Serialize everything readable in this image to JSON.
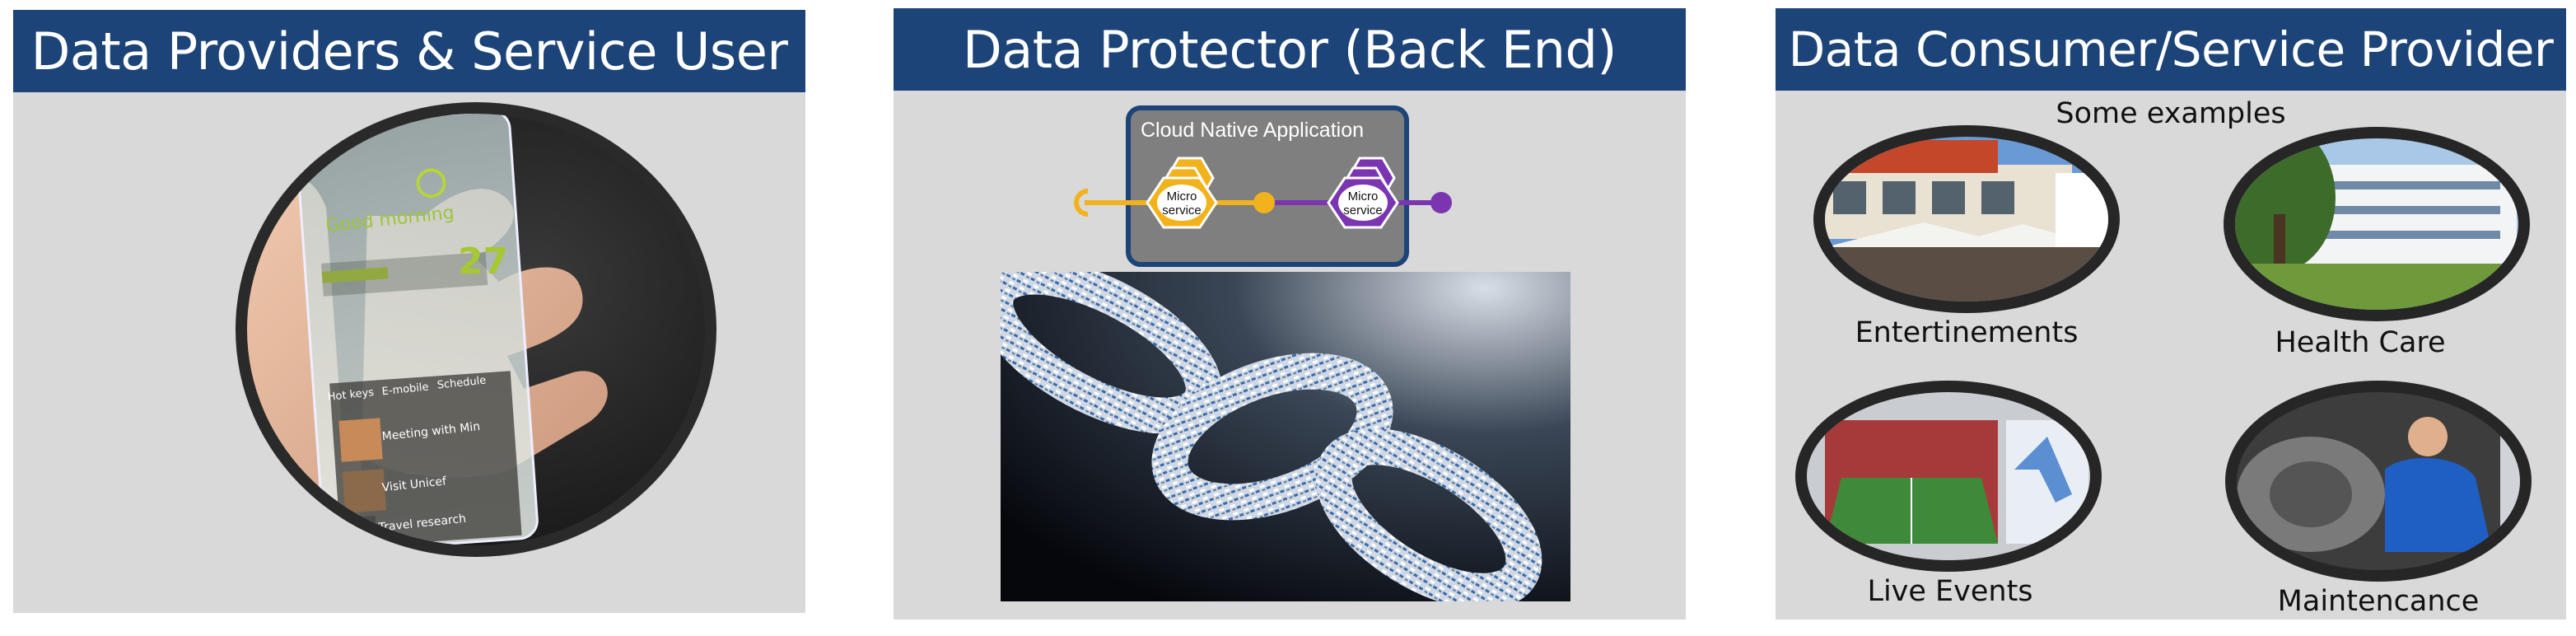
{
  "panels": {
    "left": {
      "title": "Data Providers & Service User"
    },
    "middle": {
      "title": "Data Protector (Back End)",
      "cloud_box": {
        "title": "Cloud Native Application",
        "services": [
          {
            "label": "Micro service",
            "color": "#f2b21b"
          },
          {
            "label": "Micro service",
            "color": "#7b35b0"
          }
        ]
      }
    },
    "right": {
      "title": "Data Consumer/Service Provider",
      "subtitle": "Some examples",
      "examples": [
        {
          "label": "Entertinements"
        },
        {
          "label": "Health Care"
        },
        {
          "label": "Live Events"
        },
        {
          "label": "Maintencance"
        }
      ]
    }
  },
  "phone_screen": {
    "greeting": "Good morning",
    "temperature": "27",
    "tabs": [
      "Hot keys",
      "E-mobile",
      "Schedule"
    ],
    "items": [
      "Meeting with Min",
      "Visit Unicef",
      "Travel research"
    ]
  },
  "colors": {
    "header_bg": "#1c4478",
    "panel_bg": "#d9d9d9",
    "service_yellow": "#f2b21b",
    "service_purple": "#7b35b0"
  }
}
